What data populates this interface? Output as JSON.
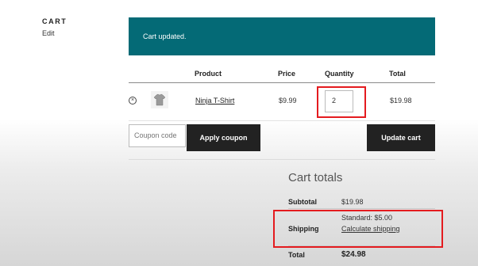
{
  "sidebar": {
    "title": "CART",
    "edit_label": "Edit"
  },
  "notice": {
    "message": "Cart updated."
  },
  "table": {
    "headers": {
      "product": "Product",
      "price": "Price",
      "quantity": "Quantity",
      "total": "Total"
    },
    "row": {
      "remove_symbol": "×",
      "name": "Ninja T-Shirt",
      "price": "$9.99",
      "quantity": "2",
      "total": "$19.98"
    }
  },
  "actions": {
    "coupon_placeholder": "Coupon code",
    "apply_label": "Apply coupon",
    "update_label": "Update cart"
  },
  "totals": {
    "title": "Cart totals",
    "subtotal_label": "Subtotal",
    "subtotal_value": "$19.98",
    "shipping_label": "Shipping",
    "shipping_option": "Standard: $5.00",
    "shipping_link": "Calculate shipping",
    "total_label": "Total",
    "total_value": "$24.98"
  },
  "colors": {
    "notice_bg": "#046a76",
    "button_bg": "#222222",
    "highlight": "#e41b1f"
  }
}
